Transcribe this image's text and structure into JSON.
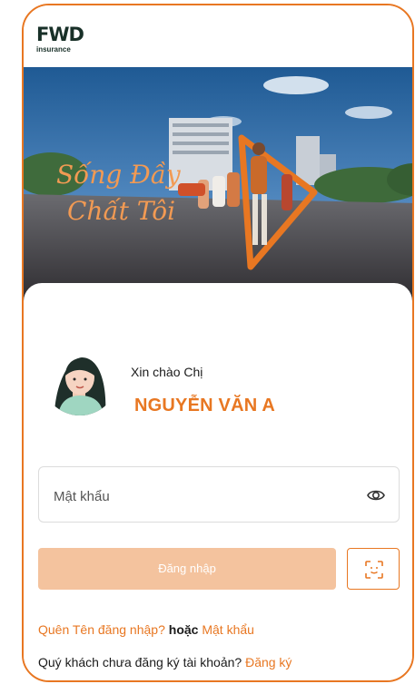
{
  "brand": {
    "logo_text": "FWD",
    "logo_sub": "insurance",
    "accent": "#e87722",
    "dark": "#183028"
  },
  "hero": {
    "slogan_line1": "Sống Đầy",
    "slogan_line2": "Chất Tôi"
  },
  "greeting": {
    "salutation": "Xin chào Chị",
    "name": "NGUYỄN VĂN A"
  },
  "password": {
    "placeholder": "Mật khẩu",
    "value": ""
  },
  "buttons": {
    "login": "Đăng nhập",
    "login_color": "#f4c39e"
  },
  "links": {
    "forgot_username": "Quên Tên đăng nhập?",
    "or_text": "hoặc",
    "forgot_password": "Mật khẩu",
    "no_account": "Quý khách chưa đăng ký tài khoản?",
    "register": "Đăng ký"
  },
  "icons": {
    "eye": "eye-icon",
    "face_id": "face-id-icon"
  }
}
